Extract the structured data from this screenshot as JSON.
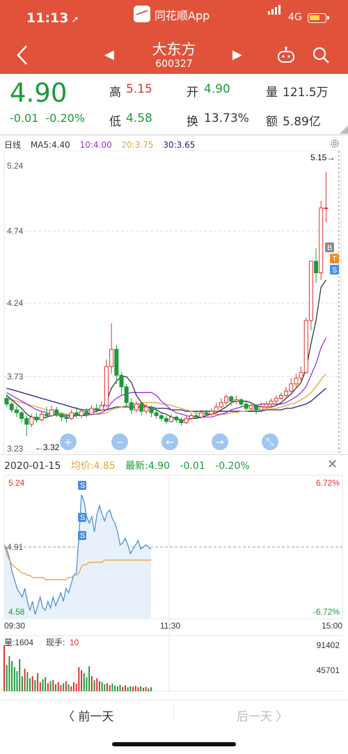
{
  "status": {
    "time": "11:13",
    "network": "4G"
  },
  "app": {
    "name": "同花顺App"
  },
  "stock": {
    "name": "大东方",
    "code": "600327"
  },
  "quote": {
    "price": "4.90",
    "change": "-0.01",
    "change_pct": "-0.20%",
    "high_label": "高",
    "high": "5.15",
    "open_label": "开",
    "open": "4.90",
    "volume_label": "量",
    "volume": "121.5万",
    "low_label": "低",
    "low": "4.58",
    "turnover_label": "换",
    "turnover": "13.73%",
    "amount_label": "额",
    "amount": "5.89亿"
  },
  "kline_header": {
    "period": "日线",
    "ma5": "MA5:4.40",
    "ma10": "10:4.00",
    "ma20": "20:3.75",
    "ma30": "30:3.65",
    "colors": {
      "ma5": "#333333",
      "ma10": "#9b30d9",
      "ma20": "#e8a33a",
      "ma30": "#1b1b8a"
    }
  },
  "intraday_header": {
    "date": "2020-01-15",
    "avg": "均价:4.85",
    "latest": "最新:4.90",
    "change": "-0.01",
    "change_pct": "-0.20%"
  },
  "bottom_nav": {
    "prev": "前一天",
    "next": "后一天"
  },
  "chart_data": [
    {
      "type": "candlestick",
      "title": "日线",
      "y_ticks": [
        "5.24",
        "4.74",
        "4.24",
        "3.73",
        "3.23"
      ],
      "ylim": [
        3.23,
        5.24
      ],
      "annotations": {
        "max": "5.15",
        "min": "3.32"
      },
      "markers": [
        "B",
        "T",
        "S"
      ],
      "candles": [
        [
          3.58,
          3.54,
          3.61,
          3.52
        ],
        [
          3.54,
          3.5,
          3.56,
          3.48
        ],
        [
          3.5,
          3.48,
          3.53,
          3.45
        ],
        [
          3.48,
          3.44,
          3.49,
          3.41
        ],
        [
          3.44,
          3.4,
          3.46,
          3.32
        ],
        [
          3.4,
          3.45,
          3.47,
          3.38
        ],
        [
          3.45,
          3.43,
          3.48,
          3.41
        ],
        [
          3.43,
          3.47,
          3.49,
          3.42
        ],
        [
          3.47,
          3.46,
          3.52,
          3.44
        ],
        [
          3.46,
          3.5,
          3.53,
          3.45
        ],
        [
          3.5,
          3.47,
          3.52,
          3.45
        ],
        [
          3.47,
          3.45,
          3.48,
          3.42
        ],
        [
          3.45,
          3.44,
          3.47,
          3.41
        ],
        [
          3.44,
          3.48,
          3.5,
          3.43
        ],
        [
          3.48,
          3.46,
          3.52,
          3.44
        ],
        [
          3.46,
          3.49,
          3.51,
          3.44
        ],
        [
          3.49,
          3.47,
          3.51,
          3.45
        ],
        [
          3.47,
          3.51,
          3.53,
          3.46
        ],
        [
          3.51,
          3.5,
          3.54,
          3.48
        ],
        [
          3.5,
          3.53,
          3.56,
          3.49
        ],
        [
          3.53,
          3.8,
          3.85,
          3.52
        ],
        [
          3.8,
          3.92,
          4.1,
          3.75
        ],
        [
          3.92,
          3.74,
          3.95,
          3.68
        ],
        [
          3.74,
          3.66,
          3.76,
          3.6
        ],
        [
          3.66,
          3.55,
          3.68,
          3.52
        ],
        [
          3.55,
          3.5,
          3.58,
          3.47
        ],
        [
          3.5,
          3.54,
          3.56,
          3.48
        ],
        [
          3.54,
          3.49,
          3.55,
          3.46
        ],
        [
          3.49,
          3.52,
          3.54,
          3.47
        ],
        [
          3.52,
          3.48,
          3.53,
          3.45
        ],
        [
          3.48,
          3.46,
          3.5,
          3.44
        ],
        [
          3.46,
          3.44,
          3.48,
          3.42
        ],
        [
          3.44,
          3.42,
          3.46,
          3.4
        ],
        [
          3.42,
          3.45,
          3.47,
          3.41
        ],
        [
          3.45,
          3.43,
          3.46,
          3.41
        ],
        [
          3.43,
          3.41,
          3.45,
          3.39
        ],
        [
          3.41,
          3.44,
          3.46,
          3.4
        ],
        [
          3.44,
          3.46,
          3.48,
          3.43
        ],
        [
          3.46,
          3.45,
          3.48,
          3.44
        ],
        [
          3.45,
          3.48,
          3.5,
          3.44
        ],
        [
          3.48,
          3.47,
          3.5,
          3.46
        ],
        [
          3.47,
          3.49,
          3.51,
          3.46
        ],
        [
          3.49,
          3.52,
          3.55,
          3.48
        ],
        [
          3.52,
          3.55,
          3.58,
          3.51
        ],
        [
          3.55,
          3.59,
          3.61,
          3.53
        ],
        [
          3.59,
          3.56,
          3.6,
          3.53
        ],
        [
          3.56,
          3.57,
          3.6,
          3.54
        ],
        [
          3.57,
          3.54,
          3.58,
          3.52
        ],
        [
          3.54,
          3.51,
          3.56,
          3.49
        ],
        [
          3.51,
          3.53,
          3.55,
          3.5
        ],
        [
          3.53,
          3.5,
          3.54,
          3.47
        ],
        [
          3.5,
          3.52,
          3.55,
          3.49
        ],
        [
          3.52,
          3.54,
          3.56,
          3.51
        ],
        [
          3.54,
          3.56,
          3.58,
          3.52
        ],
        [
          3.56,
          3.58,
          3.6,
          3.54
        ],
        [
          3.58,
          3.6,
          3.62,
          3.57
        ],
        [
          3.6,
          3.63,
          3.66,
          3.58
        ],
        [
          3.63,
          3.68,
          3.72,
          3.62
        ],
        [
          3.68,
          3.72,
          3.75,
          3.66
        ],
        [
          3.72,
          3.76,
          3.8,
          3.7
        ],
        [
          3.76,
          4.12,
          4.14,
          3.75
        ],
        [
          4.12,
          4.53,
          4.53,
          4.05
        ],
        [
          4.53,
          4.45,
          4.62,
          4.38
        ],
        [
          4.45,
          4.9,
          4.95,
          4.4
        ],
        [
          4.9,
          4.9,
          5.15,
          4.8
        ]
      ],
      "ma5": [
        3.6,
        3.57,
        3.54,
        3.51,
        3.47,
        3.45,
        3.44,
        3.44,
        3.45,
        3.46,
        3.47,
        3.47,
        3.46,
        3.46,
        3.46,
        3.46,
        3.47,
        3.48,
        3.49,
        3.5,
        3.56,
        3.65,
        3.7,
        3.73,
        3.73,
        3.69,
        3.6,
        3.55,
        3.52,
        3.51,
        3.5,
        3.48,
        3.47,
        3.45,
        3.44,
        3.43,
        3.43,
        3.44,
        3.44,
        3.45,
        3.46,
        3.47,
        3.48,
        3.5,
        3.52,
        3.55,
        3.56,
        3.56,
        3.56,
        3.55,
        3.53,
        3.52,
        3.52,
        3.52,
        3.53,
        3.55,
        3.58,
        3.61,
        3.65,
        3.69,
        3.78,
        3.96,
        4.12,
        4.35,
        4.4
      ],
      "ma10": [
        3.62,
        3.6,
        3.58,
        3.56,
        3.54,
        3.52,
        3.5,
        3.49,
        3.48,
        3.47,
        3.46,
        3.46,
        3.45,
        3.45,
        3.46,
        3.46,
        3.46,
        3.47,
        3.47,
        3.48,
        3.5,
        3.55,
        3.58,
        3.6,
        3.61,
        3.62,
        3.62,
        3.62,
        3.62,
        3.62,
        3.6,
        3.56,
        3.53,
        3.5,
        3.48,
        3.47,
        3.46,
        3.45,
        3.45,
        3.45,
        3.45,
        3.45,
        3.46,
        3.47,
        3.48,
        3.5,
        3.51,
        3.52,
        3.53,
        3.53,
        3.53,
        3.54,
        3.54,
        3.54,
        3.54,
        3.54,
        3.55,
        3.57,
        3.59,
        3.62,
        3.66,
        3.74,
        3.82,
        3.93,
        4.0
      ],
      "ma20": [
        3.58,
        3.57,
        3.56,
        3.55,
        3.54,
        3.53,
        3.52,
        3.51,
        3.5,
        3.49,
        3.48,
        3.48,
        3.47,
        3.47,
        3.47,
        3.47,
        3.47,
        3.47,
        3.47,
        3.47,
        3.48,
        3.5,
        3.51,
        3.52,
        3.53,
        3.54,
        3.54,
        3.55,
        3.55,
        3.55,
        3.55,
        3.54,
        3.54,
        3.53,
        3.52,
        3.51,
        3.5,
        3.49,
        3.48,
        3.47,
        3.47,
        3.47,
        3.47,
        3.47,
        3.47,
        3.48,
        3.48,
        3.49,
        3.49,
        3.5,
        3.5,
        3.5,
        3.51,
        3.51,
        3.51,
        3.52,
        3.53,
        3.54,
        3.55,
        3.57,
        3.59,
        3.62,
        3.66,
        3.71,
        3.75
      ],
      "ma30": [
        3.65,
        3.64,
        3.63,
        3.62,
        3.61,
        3.6,
        3.59,
        3.58,
        3.57,
        3.56,
        3.55,
        3.54,
        3.53,
        3.52,
        3.51,
        3.5,
        3.5,
        3.5,
        3.5,
        3.5,
        3.5,
        3.51,
        3.52,
        3.52,
        3.52,
        3.52,
        3.52,
        3.52,
        3.52,
        3.52,
        3.51,
        3.51,
        3.51,
        3.5,
        3.5,
        3.5,
        3.49,
        3.49,
        3.49,
        3.49,
        3.49,
        3.49,
        3.49,
        3.49,
        3.49,
        3.49,
        3.49,
        3.49,
        3.49,
        3.49,
        3.49,
        3.49,
        3.5,
        3.5,
        3.5,
        3.5,
        3.51,
        3.51,
        3.52,
        3.53,
        3.54,
        3.56,
        3.59,
        3.62,
        3.65
      ]
    },
    {
      "type": "line",
      "title": "分时",
      "y_left_ticks": [
        "5.24",
        "4.91",
        "4.58"
      ],
      "y_right_ticks": [
        "6.72%",
        "-6.72%"
      ],
      "x_ticks": [
        "09:30",
        "11:30",
        "15:00"
      ],
      "ylim": [
        4.58,
        5.24
      ],
      "prev_close": 4.91,
      "markers": [
        "S",
        "S",
        "S"
      ],
      "price": [
        4.92,
        4.9,
        4.86,
        4.8,
        4.76,
        4.72,
        4.7,
        4.68,
        4.72,
        4.66,
        4.62,
        4.66,
        4.6,
        4.64,
        4.68,
        4.63,
        4.62,
        4.66,
        4.63,
        4.68,
        4.64,
        4.67,
        4.7,
        4.66,
        4.72,
        4.7,
        4.74,
        4.78,
        4.79,
        4.96,
        5.15,
        5.12,
        5.05,
        5.02,
        5.05,
        4.98,
        5.06,
        5.1,
        5.06,
        5.03,
        5.07,
        5.08,
        5.04,
        5.02,
        4.98,
        4.92,
        4.93,
        4.95,
        4.92,
        4.88,
        4.9,
        4.92,
        4.94,
        4.9,
        4.91,
        4.92,
        4.91,
        4.9
      ],
      "avg": [
        4.92,
        4.88,
        4.85,
        4.83,
        4.82,
        4.81,
        4.8,
        4.79,
        4.79,
        4.78,
        4.78,
        4.77,
        4.77,
        4.77,
        4.77,
        4.77,
        4.76,
        4.76,
        4.76,
        4.76,
        4.76,
        4.76,
        4.76,
        4.76,
        4.76,
        4.77,
        4.77,
        4.78,
        4.78,
        4.79,
        4.82,
        4.83,
        4.83,
        4.84,
        4.84,
        4.84,
        4.84,
        4.84,
        4.84,
        4.85,
        4.85,
        4.85,
        4.85,
        4.85,
        4.85,
        4.85,
        4.85,
        4.85,
        4.85,
        4.85,
        4.85,
        4.85,
        4.85,
        4.85,
        4.85,
        4.85,
        4.85,
        4.85
      ],
      "volume_label": "量:1604",
      "current_hand_label": "现手:",
      "current_hand": "10",
      "volume_ticks": [
        "91402",
        "45701"
      ],
      "volume": [
        91402,
        52000,
        70000,
        60000,
        48000,
        40000,
        64000,
        30000,
        45000,
        38000,
        26000,
        30000,
        22000,
        36000,
        18000,
        24000,
        28000,
        16000,
        20000,
        22000,
        14000,
        18000,
        12000,
        16000,
        20000,
        14000,
        10000,
        18000,
        15000,
        48000,
        42000,
        36000,
        28000,
        50000,
        30000,
        22000,
        26000,
        20000,
        18000,
        14000,
        16000,
        12000,
        15000,
        11000,
        10000,
        13000,
        9000,
        12000,
        8000,
        10000,
        9000,
        11000,
        8000,
        10000,
        7000,
        9000,
        6000,
        8000
      ]
    }
  ]
}
